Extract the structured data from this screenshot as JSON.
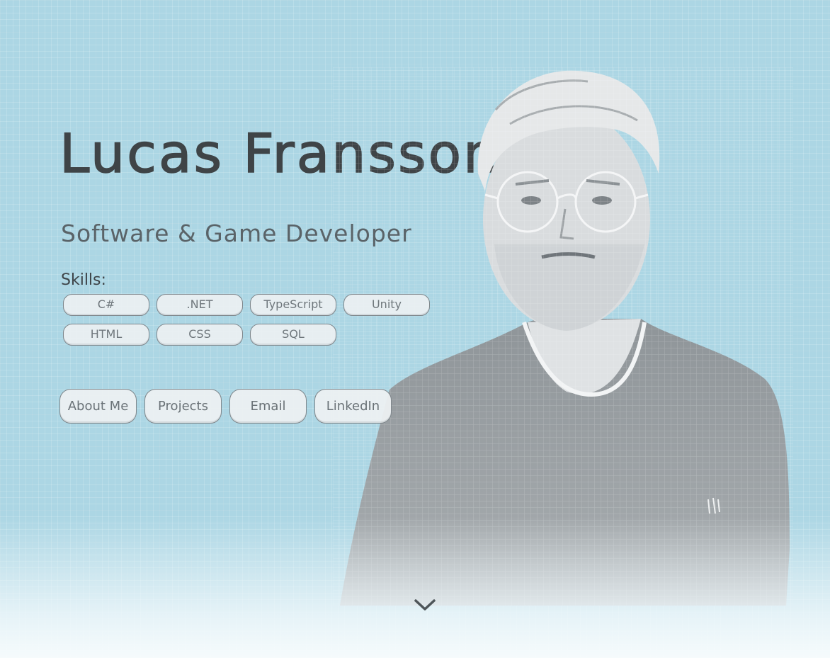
{
  "hero": {
    "name": "Lucas Fransson",
    "tagline": "Software & Game Developer",
    "skills_label": "Skills:",
    "skills": [
      "C#",
      ".NET",
      "TypeScript",
      "Unity",
      "HTML",
      "CSS",
      "SQL"
    ]
  },
  "actions": {
    "about": "About Me",
    "projects": "Projects",
    "email": "Email",
    "linkedin": "LinkedIn"
  },
  "scroll": {
    "icon": "chevron-down-icon"
  },
  "colors": {
    "background": "#acd6e4",
    "heading": "#3f4447",
    "button_fill": "#eceff1",
    "button_border": "#7e868b"
  }
}
